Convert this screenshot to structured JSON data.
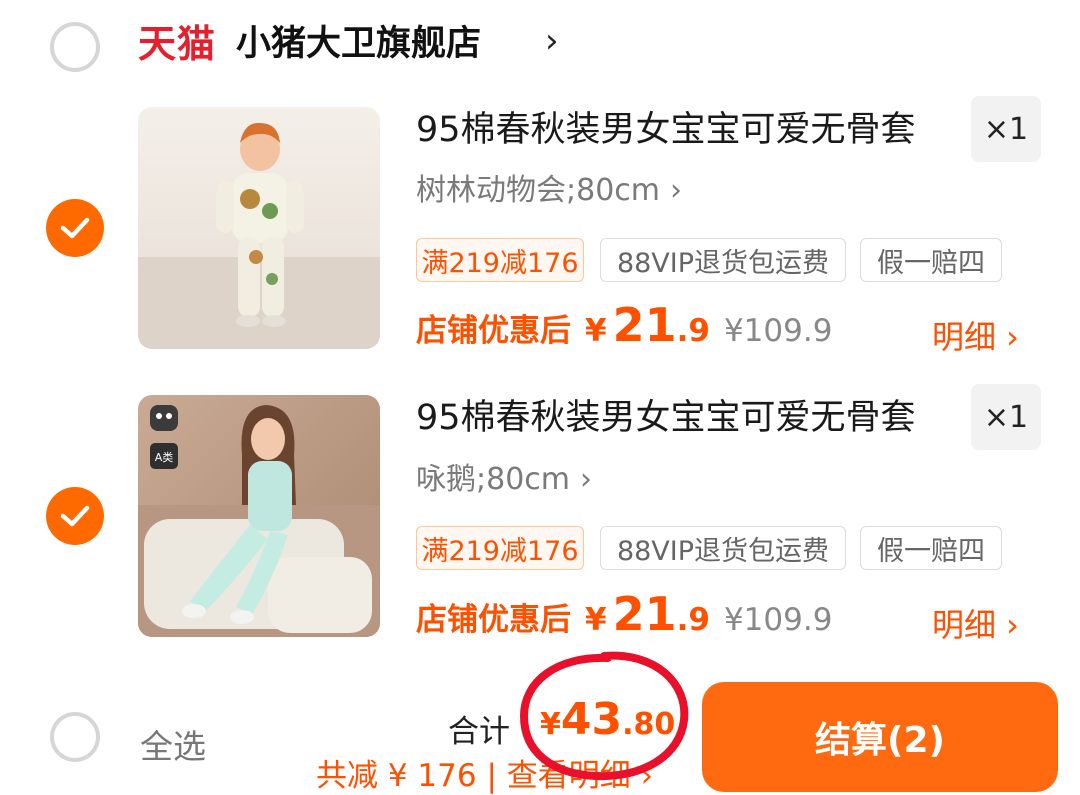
{
  "store": {
    "platform_logo": "天猫",
    "name": "小猪大卫旗舰店",
    "chevron": "›"
  },
  "items": [
    {
      "title": "95棉春秋装男女宝宝可爱无骨套",
      "sku": "树林动物会;80cm",
      "sku_chevron": "›",
      "quantity": "×1",
      "tags": [
        "满219减176",
        "88VIP退货包运费",
        "假一赔四"
      ],
      "price_label": "店铺优惠后",
      "price_yen": "¥",
      "price_int": "21",
      "price_dec": ".9",
      "original_price": "¥109.9",
      "detail_link": "明细 ›",
      "checked": true
    },
    {
      "title": "95棉春秋装男女宝宝可爱无骨套",
      "sku": "咏鹅;80cm",
      "sku_chevron": "›",
      "quantity": "×1",
      "tags": [
        "满219减176",
        "88VIP退货包运费",
        "假一赔四"
      ],
      "price_label": "店铺优惠后",
      "price_yen": "¥",
      "price_int": "21",
      "price_dec": ".9",
      "original_price": "¥109.9",
      "detail_link": "明细 ›",
      "checked": true,
      "image_badge": "A类"
    }
  ],
  "footer": {
    "select_all_label": "全选",
    "total_label": "合计",
    "total_yen": "¥",
    "total_int": "43",
    "total_dec": ".80",
    "discount_text": "共减 ¥ 176 | 查看明细 ›",
    "checkout_label": "结算(2)"
  },
  "colors": {
    "accent": "#ff6a00",
    "tmall_red": "#e5202e",
    "annotation_circle": "#e8102a"
  },
  "icons": {
    "checked_radio": "checkmark-icon",
    "store_chevron": "chevron-right-icon"
  }
}
